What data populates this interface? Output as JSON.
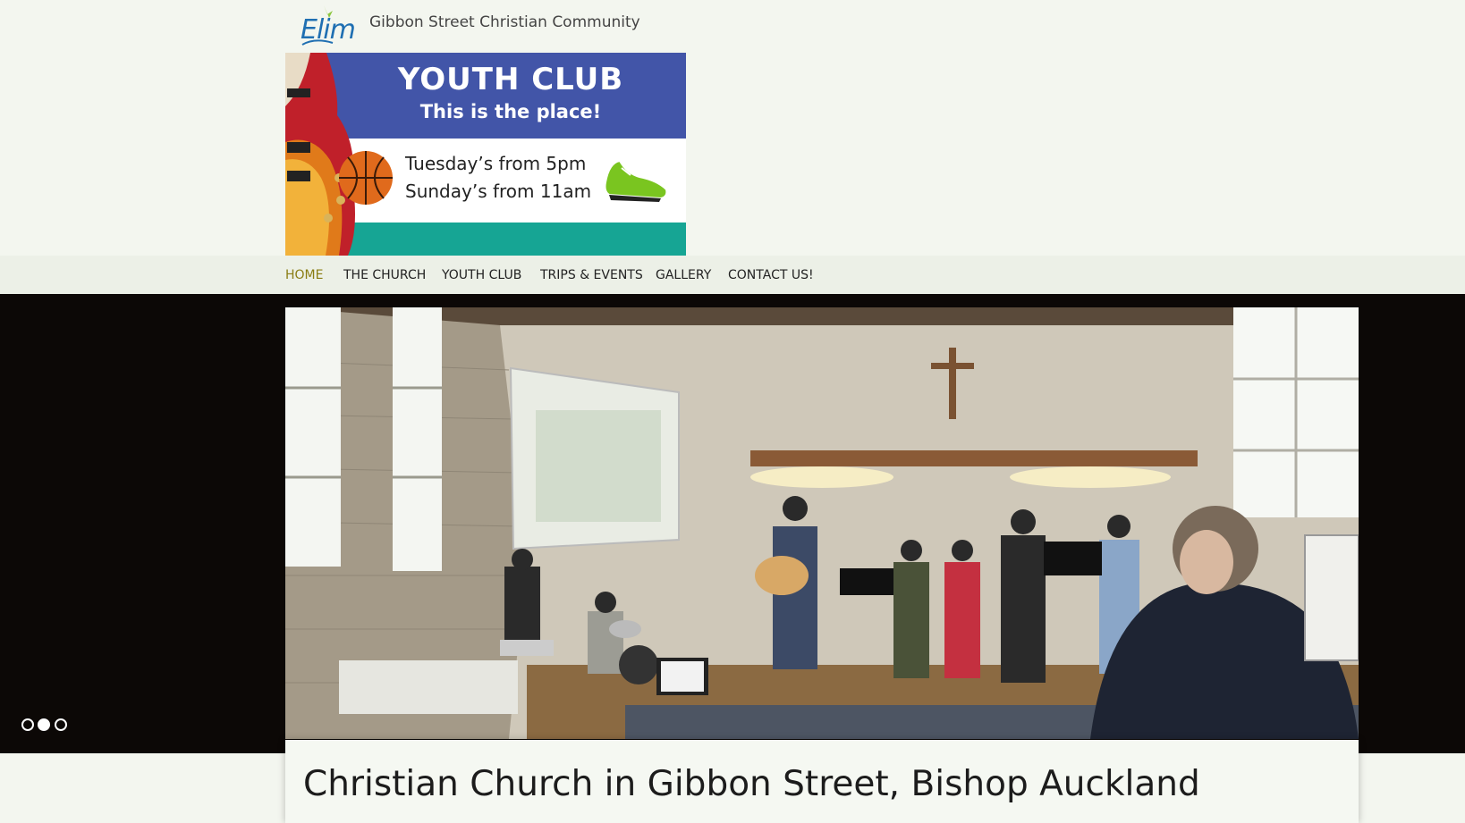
{
  "header": {
    "logo_text": "Elim",
    "site_name": "Gibbon Street Christian Community"
  },
  "banner": {
    "title": "YOUTH CLUB",
    "subtitle": "This is the place!",
    "line1": "Tuesday’s from 5pm",
    "line2": "Sunday’s from 11am",
    "colors": {
      "top": "#4255a8",
      "bottom": "#16a594"
    }
  },
  "nav": {
    "items": [
      {
        "label": "HOME",
        "active": true
      },
      {
        "label": "THE CHURCH"
      },
      {
        "label": "YOUTH CLUB"
      },
      {
        "label": "TRIPS & EVENTS"
      },
      {
        "label": "GALLERY"
      },
      {
        "label": "CONTACT US!"
      }
    ],
    "active_color": "#8a7d14"
  },
  "slider": {
    "slide_count": 3,
    "active_index": 1
  },
  "main": {
    "page_title": "Christian Church in Gibbon Street, Bishop Auckland"
  }
}
